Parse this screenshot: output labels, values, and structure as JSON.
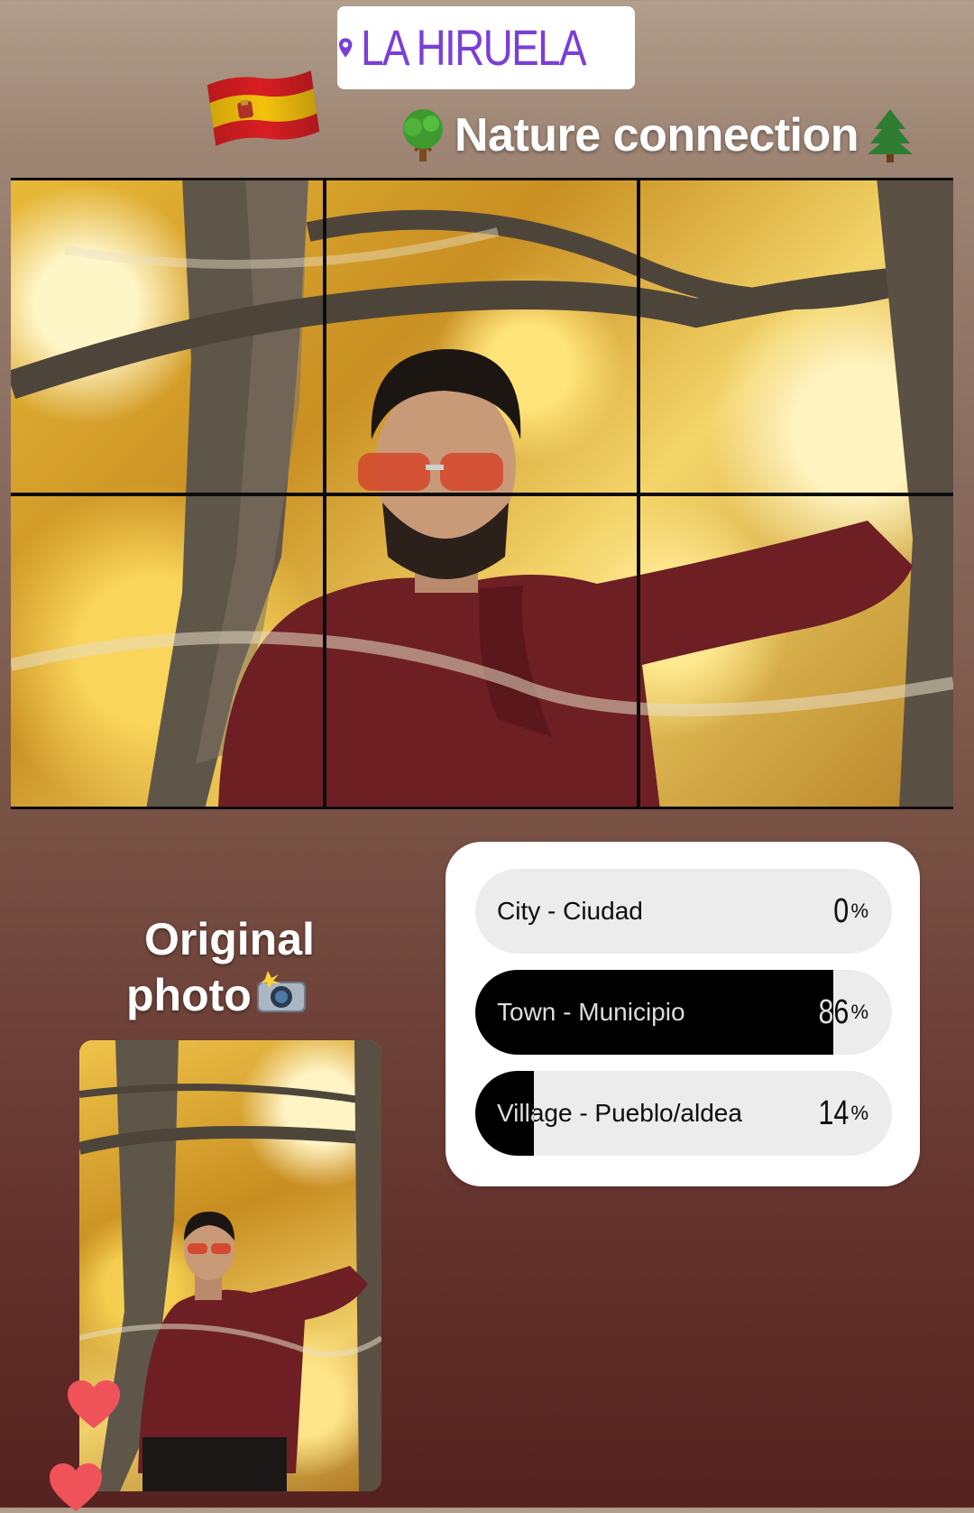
{
  "location_sticker": {
    "label": "LA HIRUELA",
    "icon": "location-pin-icon",
    "color": "#7b3fd6"
  },
  "flag": {
    "icon": "spain-flag-icon"
  },
  "caption": {
    "text": "Nature connection",
    "leading_icon": "deciduous-tree-icon",
    "trailing_icon": "evergreen-tree-icon"
  },
  "main_photo": {
    "subject": "photo"
  },
  "poll": {
    "options": [
      {
        "label": "City - Ciudad",
        "percent": 0,
        "percent_text": "0"
      },
      {
        "label": "Town - Municipio",
        "percent": 86,
        "percent_text": "86"
      },
      {
        "label": "Village - Pueblo/aldea",
        "percent": 14,
        "percent_text": "14"
      }
    ],
    "percent_sign": "%"
  },
  "original": {
    "line1": "Original",
    "line2": "photo",
    "icon": "camera-flash-icon"
  },
  "reactions": {
    "icon": "heart-icon",
    "color": "#f0525a"
  }
}
